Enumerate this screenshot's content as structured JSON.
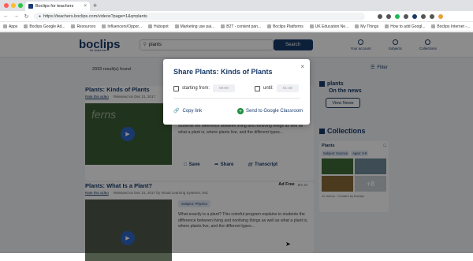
{
  "browser": {
    "tab_title": "Boclips for teachers",
    "tab_close": "×",
    "new_tab": "+",
    "url": "https://teachers.boclips.com/videos?page=1&q=plants",
    "nav": {
      "back": "←",
      "forward": "→",
      "reload": "↻"
    },
    "bookmarks": [
      "Apps",
      "Boclips Google Ad...",
      "Resources",
      "Influencers/Oppor...",
      "Hubspot",
      "Marketing use pai...",
      "B2T - content pan...",
      "Boclips Platforms",
      "UK Education Ne...",
      "My Things",
      "How to add Googl...",
      "Boclips Internet -..."
    ]
  },
  "header": {
    "logo": "boclips",
    "logo_sub": "for teachers",
    "search_value": "plants",
    "search_button": "Search",
    "icons": [
      {
        "label": "Your account",
        "icon": "user-icon"
      },
      {
        "label": "Subjects",
        "icon": "book-icon"
      },
      {
        "label": "Collections",
        "icon": "folder-icon"
      }
    ]
  },
  "results": {
    "count_text": "2933 result(s) found",
    "filter_label": "Filter"
  },
  "videos": [
    {
      "title": "Plants: Kinds of Plants",
      "rate_link": "Rate this video",
      "released": "Released on Dec 21, 2017",
      "watermark": "ferns",
      "description": "students the difference between living and nonliving things as well as what a plant is, where plants live, and the different types...",
      "actions": [
        "Save",
        "Share",
        "Transcript"
      ]
    },
    {
      "title": "Plants: What Is a Plant?",
      "rate_link": "Rate this video",
      "released": "Released on Dec 21, 2017 by Visual Learning Systems, INC",
      "ad_free": "Ad Free",
      "duration": "8m 4s",
      "subject": "Subject: Physics",
      "description": "What exactly is a plant? This colorful program explains to students the difference between living and nonliving things as well as what a plant is, where plants live, and the different types..."
    }
  ],
  "sidebar": {
    "news_title": "plants",
    "news_sub": "On the news",
    "news_button": "View News",
    "collections_title": "Collections",
    "collection": {
      "name": "Plants",
      "tags": [
        "Subject: Science",
        "Ages: 3-9"
      ],
      "more": "+8",
      "footer": "11 videos · Created by Boclips"
    }
  },
  "modal": {
    "title": "Share Plants: Kinds of Plants",
    "close": "×",
    "start_label": "starting from:",
    "start_value": "00:00",
    "until_label": "until:",
    "until_value": "01:48",
    "copy_link": "Copy link",
    "classroom": "Send to Google Classroom"
  },
  "colors": {
    "brand": "#193b6b",
    "accent": "#2f67c9",
    "classroom": "#1e8e3e"
  }
}
